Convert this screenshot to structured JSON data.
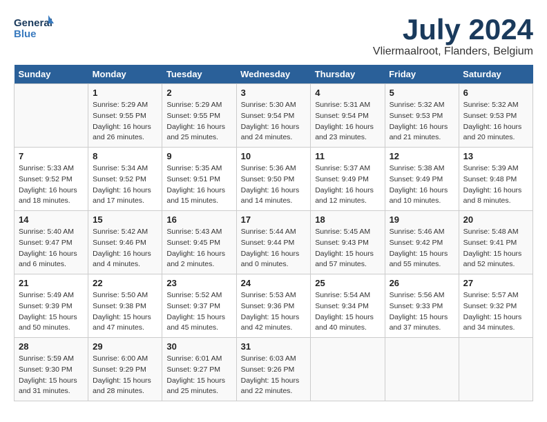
{
  "header": {
    "logo_line1": "General",
    "logo_line2": "Blue",
    "title": "July 2024",
    "subtitle": "Vliermaalroot, Flanders, Belgium"
  },
  "weekdays": [
    "Sunday",
    "Monday",
    "Tuesday",
    "Wednesday",
    "Thursday",
    "Friday",
    "Saturday"
  ],
  "weeks": [
    [
      {
        "num": "",
        "info": ""
      },
      {
        "num": "1",
        "info": "Sunrise: 5:29 AM\nSunset: 9:55 PM\nDaylight: 16 hours\nand 26 minutes."
      },
      {
        "num": "2",
        "info": "Sunrise: 5:29 AM\nSunset: 9:55 PM\nDaylight: 16 hours\nand 25 minutes."
      },
      {
        "num": "3",
        "info": "Sunrise: 5:30 AM\nSunset: 9:54 PM\nDaylight: 16 hours\nand 24 minutes."
      },
      {
        "num": "4",
        "info": "Sunrise: 5:31 AM\nSunset: 9:54 PM\nDaylight: 16 hours\nand 23 minutes."
      },
      {
        "num": "5",
        "info": "Sunrise: 5:32 AM\nSunset: 9:53 PM\nDaylight: 16 hours\nand 21 minutes."
      },
      {
        "num": "6",
        "info": "Sunrise: 5:32 AM\nSunset: 9:53 PM\nDaylight: 16 hours\nand 20 minutes."
      }
    ],
    [
      {
        "num": "7",
        "info": "Sunrise: 5:33 AM\nSunset: 9:52 PM\nDaylight: 16 hours\nand 18 minutes."
      },
      {
        "num": "8",
        "info": "Sunrise: 5:34 AM\nSunset: 9:52 PM\nDaylight: 16 hours\nand 17 minutes."
      },
      {
        "num": "9",
        "info": "Sunrise: 5:35 AM\nSunset: 9:51 PM\nDaylight: 16 hours\nand 15 minutes."
      },
      {
        "num": "10",
        "info": "Sunrise: 5:36 AM\nSunset: 9:50 PM\nDaylight: 16 hours\nand 14 minutes."
      },
      {
        "num": "11",
        "info": "Sunrise: 5:37 AM\nSunset: 9:49 PM\nDaylight: 16 hours\nand 12 minutes."
      },
      {
        "num": "12",
        "info": "Sunrise: 5:38 AM\nSunset: 9:49 PM\nDaylight: 16 hours\nand 10 minutes."
      },
      {
        "num": "13",
        "info": "Sunrise: 5:39 AM\nSunset: 9:48 PM\nDaylight: 16 hours\nand 8 minutes."
      }
    ],
    [
      {
        "num": "14",
        "info": "Sunrise: 5:40 AM\nSunset: 9:47 PM\nDaylight: 16 hours\nand 6 minutes."
      },
      {
        "num": "15",
        "info": "Sunrise: 5:42 AM\nSunset: 9:46 PM\nDaylight: 16 hours\nand 4 minutes."
      },
      {
        "num": "16",
        "info": "Sunrise: 5:43 AM\nSunset: 9:45 PM\nDaylight: 16 hours\nand 2 minutes."
      },
      {
        "num": "17",
        "info": "Sunrise: 5:44 AM\nSunset: 9:44 PM\nDaylight: 16 hours\nand 0 minutes."
      },
      {
        "num": "18",
        "info": "Sunrise: 5:45 AM\nSunset: 9:43 PM\nDaylight: 15 hours\nand 57 minutes."
      },
      {
        "num": "19",
        "info": "Sunrise: 5:46 AM\nSunset: 9:42 PM\nDaylight: 15 hours\nand 55 minutes."
      },
      {
        "num": "20",
        "info": "Sunrise: 5:48 AM\nSunset: 9:41 PM\nDaylight: 15 hours\nand 52 minutes."
      }
    ],
    [
      {
        "num": "21",
        "info": "Sunrise: 5:49 AM\nSunset: 9:39 PM\nDaylight: 15 hours\nand 50 minutes."
      },
      {
        "num": "22",
        "info": "Sunrise: 5:50 AM\nSunset: 9:38 PM\nDaylight: 15 hours\nand 47 minutes."
      },
      {
        "num": "23",
        "info": "Sunrise: 5:52 AM\nSunset: 9:37 PM\nDaylight: 15 hours\nand 45 minutes."
      },
      {
        "num": "24",
        "info": "Sunrise: 5:53 AM\nSunset: 9:36 PM\nDaylight: 15 hours\nand 42 minutes."
      },
      {
        "num": "25",
        "info": "Sunrise: 5:54 AM\nSunset: 9:34 PM\nDaylight: 15 hours\nand 40 minutes."
      },
      {
        "num": "26",
        "info": "Sunrise: 5:56 AM\nSunset: 9:33 PM\nDaylight: 15 hours\nand 37 minutes."
      },
      {
        "num": "27",
        "info": "Sunrise: 5:57 AM\nSunset: 9:32 PM\nDaylight: 15 hours\nand 34 minutes."
      }
    ],
    [
      {
        "num": "28",
        "info": "Sunrise: 5:59 AM\nSunset: 9:30 PM\nDaylight: 15 hours\nand 31 minutes."
      },
      {
        "num": "29",
        "info": "Sunrise: 6:00 AM\nSunset: 9:29 PM\nDaylight: 15 hours\nand 28 minutes."
      },
      {
        "num": "30",
        "info": "Sunrise: 6:01 AM\nSunset: 9:27 PM\nDaylight: 15 hours\nand 25 minutes."
      },
      {
        "num": "31",
        "info": "Sunrise: 6:03 AM\nSunset: 9:26 PM\nDaylight: 15 hours\nand 22 minutes."
      },
      {
        "num": "",
        "info": ""
      },
      {
        "num": "",
        "info": ""
      },
      {
        "num": "",
        "info": ""
      }
    ]
  ]
}
